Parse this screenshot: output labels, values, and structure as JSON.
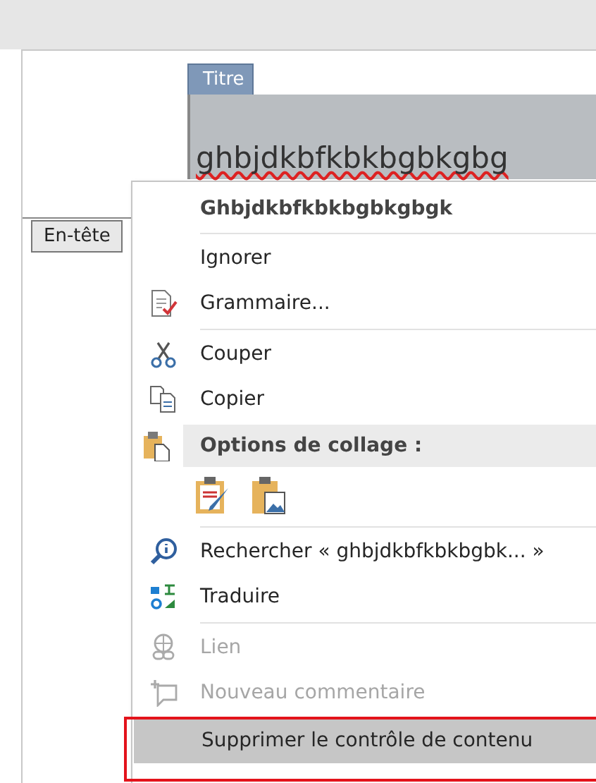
{
  "document": {
    "title_tag": "Titre",
    "title_text": "ghbjdkbfkbkbgbkgbg",
    "header_tab": "En-tête"
  },
  "context_menu": {
    "items": [
      {
        "kind": "heading",
        "label": "Ghbjdkbfkbkbgbkgbgk"
      },
      {
        "kind": "separator"
      },
      {
        "kind": "item",
        "label": "Ignorer",
        "disabled": false,
        "selected": false
      },
      {
        "kind": "item",
        "label": "Grammaire...",
        "disabled": false,
        "selected": false
      },
      {
        "kind": "separator"
      },
      {
        "kind": "item",
        "label": "Couper",
        "disabled": false,
        "selected": false
      },
      {
        "kind": "item",
        "label": "Copier",
        "disabled": false,
        "selected": false
      },
      {
        "kind": "section",
        "label": "Options de collage :"
      },
      {
        "kind": "paste_options"
      },
      {
        "kind": "separator"
      },
      {
        "kind": "item",
        "label": "Rechercher « ghbjdkbfkbkbgbk... »",
        "disabled": false,
        "selected": false
      },
      {
        "kind": "item",
        "label": "Traduire",
        "disabled": false,
        "selected": false
      },
      {
        "kind": "separator"
      },
      {
        "kind": "item",
        "label": "Lien",
        "disabled": true,
        "selected": false
      },
      {
        "kind": "item",
        "label": "Nouveau commentaire",
        "disabled": true,
        "selected": false
      },
      {
        "kind": "item",
        "label": "Supprimer le contrôle de contenu",
        "disabled": false,
        "selected": true,
        "annotated": true
      }
    ]
  }
}
